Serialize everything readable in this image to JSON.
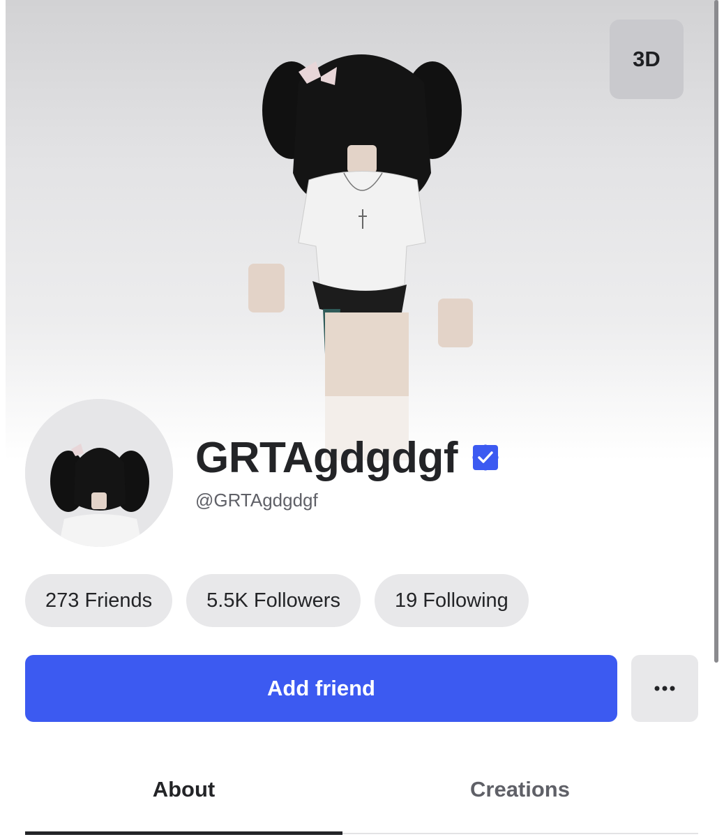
{
  "hero": {
    "view_toggle_label": "3D"
  },
  "profile": {
    "display_name": "GRTAgdgdgf",
    "username": "@GRTAgdgdgf",
    "verified": true
  },
  "stats": {
    "friends": "273 Friends",
    "followers": "5.5K Followers",
    "following": "19 Following"
  },
  "actions": {
    "add_friend_label": "Add friend",
    "more_icon": "ellipsis-icon"
  },
  "tabs": [
    {
      "label": "About",
      "active": true
    },
    {
      "label": "Creations",
      "active": false
    }
  ],
  "colors": {
    "primary": "#3c5af1",
    "badge": "#3c5af1",
    "text": "#232427",
    "muted": "#5f6067",
    "pill_bg": "#e8e8ea"
  }
}
